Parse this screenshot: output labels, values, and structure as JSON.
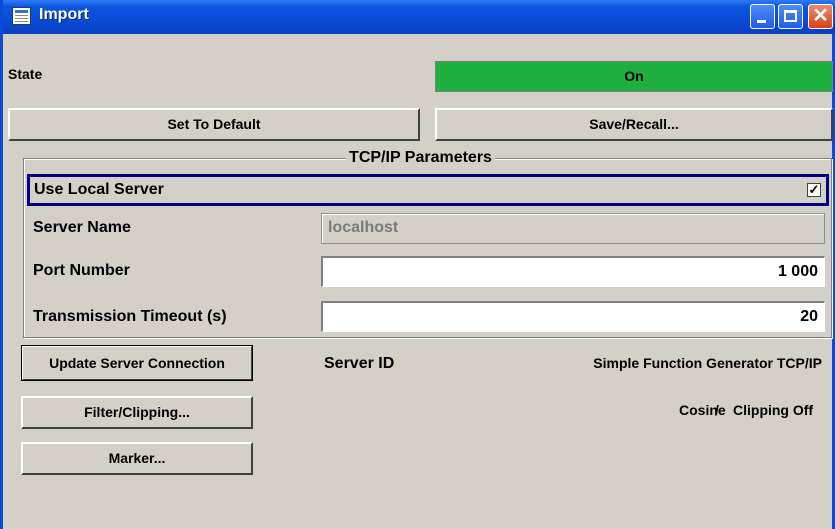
{
  "window": {
    "title": "Import"
  },
  "state": {
    "label": "State",
    "value": "On"
  },
  "buttons": {
    "set_default": "Set To Default",
    "save_recall": "Save/Recall...",
    "update_server": "Update Server Connection",
    "filter_clipping": "Filter/Clipping...",
    "marker": "Marker..."
  },
  "tcpip": {
    "title": "TCP/IP Parameters",
    "use_local_server": {
      "label": "Use Local Server",
      "checked": true,
      "check_glyph": "✓"
    },
    "server_name": {
      "label": "Server Name",
      "value": "localhost"
    },
    "port_number": {
      "label": "Port Number",
      "value": "1 000"
    },
    "transmission_timeout": {
      "label": "Transmission Timeout (s)",
      "value": "20"
    }
  },
  "server_id": {
    "label": "Server ID",
    "value": "Simple Function Generator TCP/IP"
  },
  "filter_status": {
    "filter": "Cosine",
    "separator": "/",
    "clipping": "Clipping Off"
  },
  "colors": {
    "titlebar": "#0a4bd8",
    "state_on": "#20b040",
    "background": "#d4d0c8",
    "selection_border": "#000080"
  },
  "icons": {
    "window": "window-app-icon",
    "minimize": "minimize-icon",
    "maximize": "maximize-icon",
    "close": "close-icon"
  }
}
